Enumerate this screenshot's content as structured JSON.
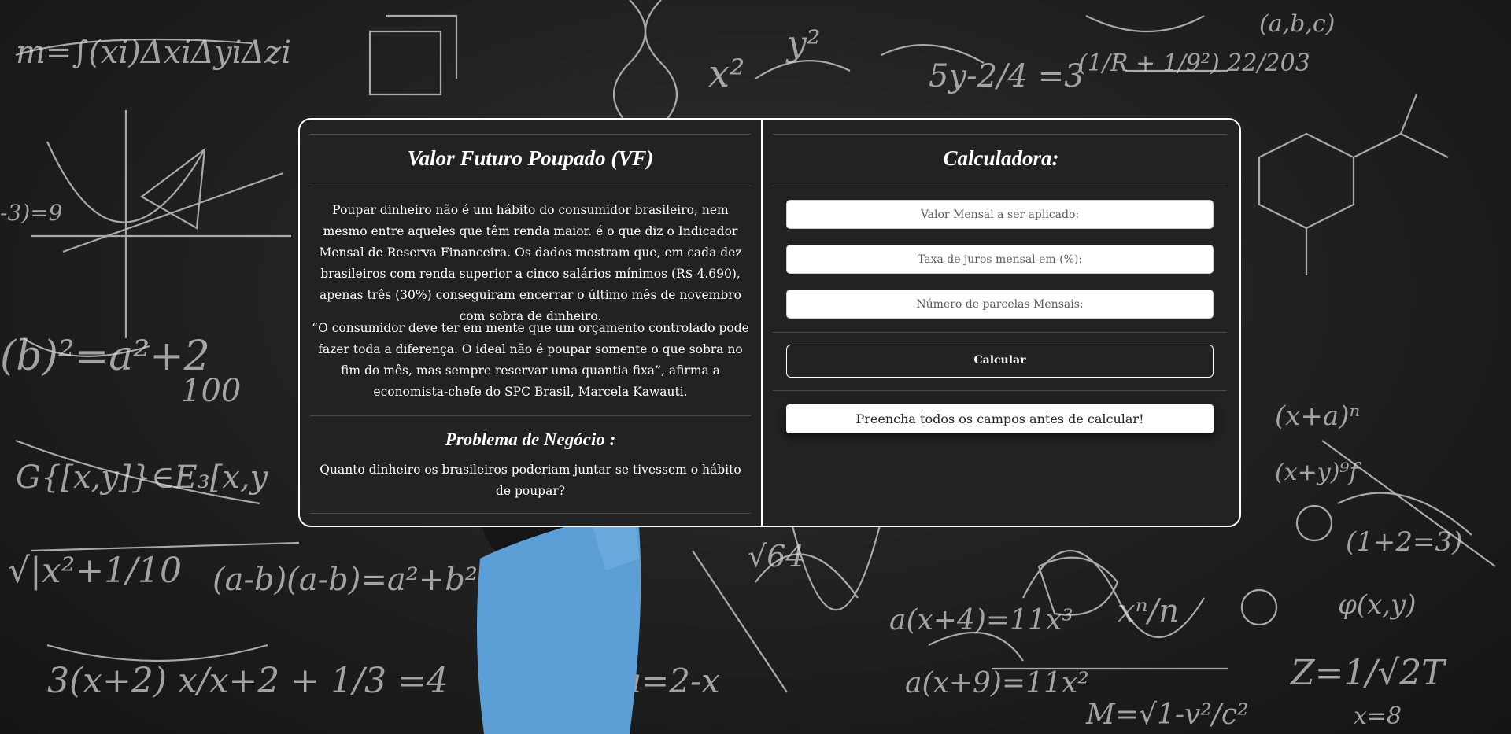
{
  "left_panel": {
    "title": "Valor Futuro Poupado (VF)",
    "paragraph1": "Poupar dinheiro não é um hábito do consumidor brasileiro, nem mesmo entre aqueles que têm renda maior. é o que diz o Indicador Mensal de Reserva Financeira. Os dados mostram que, em cada dez brasileiros com renda superior a cinco salários mínimos (R$ 4.690), apenas três (30%) conseguiram encerrar o último mês de novembro com sobra de dinheiro.",
    "paragraph2": "“O consumidor deve ter em mente que um orçamento controlado pode fazer toda a diferença. O ideal não é poupar somente o que sobra no fim do mês, mas sempre reservar uma quantia fixa”, afirma a economista-chefe do SPC Brasil, Marcela Kawauti.",
    "problem_title": "Problema de Negócio :",
    "problem_text": "Quanto dinheiro os brasileiros poderiam juntar se tivessem o hábito de poupar?"
  },
  "calculator": {
    "title": "Calculadora:",
    "monthly_value_placeholder": "Valor Mensal a ser aplicado:",
    "interest_rate_placeholder": "Taxa de juros mensal em (%):",
    "installments_placeholder": "Número de parcelas Mensais:",
    "calculate_label": "Calcular",
    "result_text": "Preencha todos os campos antes de calcular!"
  },
  "colors": {
    "panel_bg": "#222222",
    "border": "#ffffff",
    "text": "#ffffff"
  },
  "icons": [
    "chalkboard-background"
  ]
}
